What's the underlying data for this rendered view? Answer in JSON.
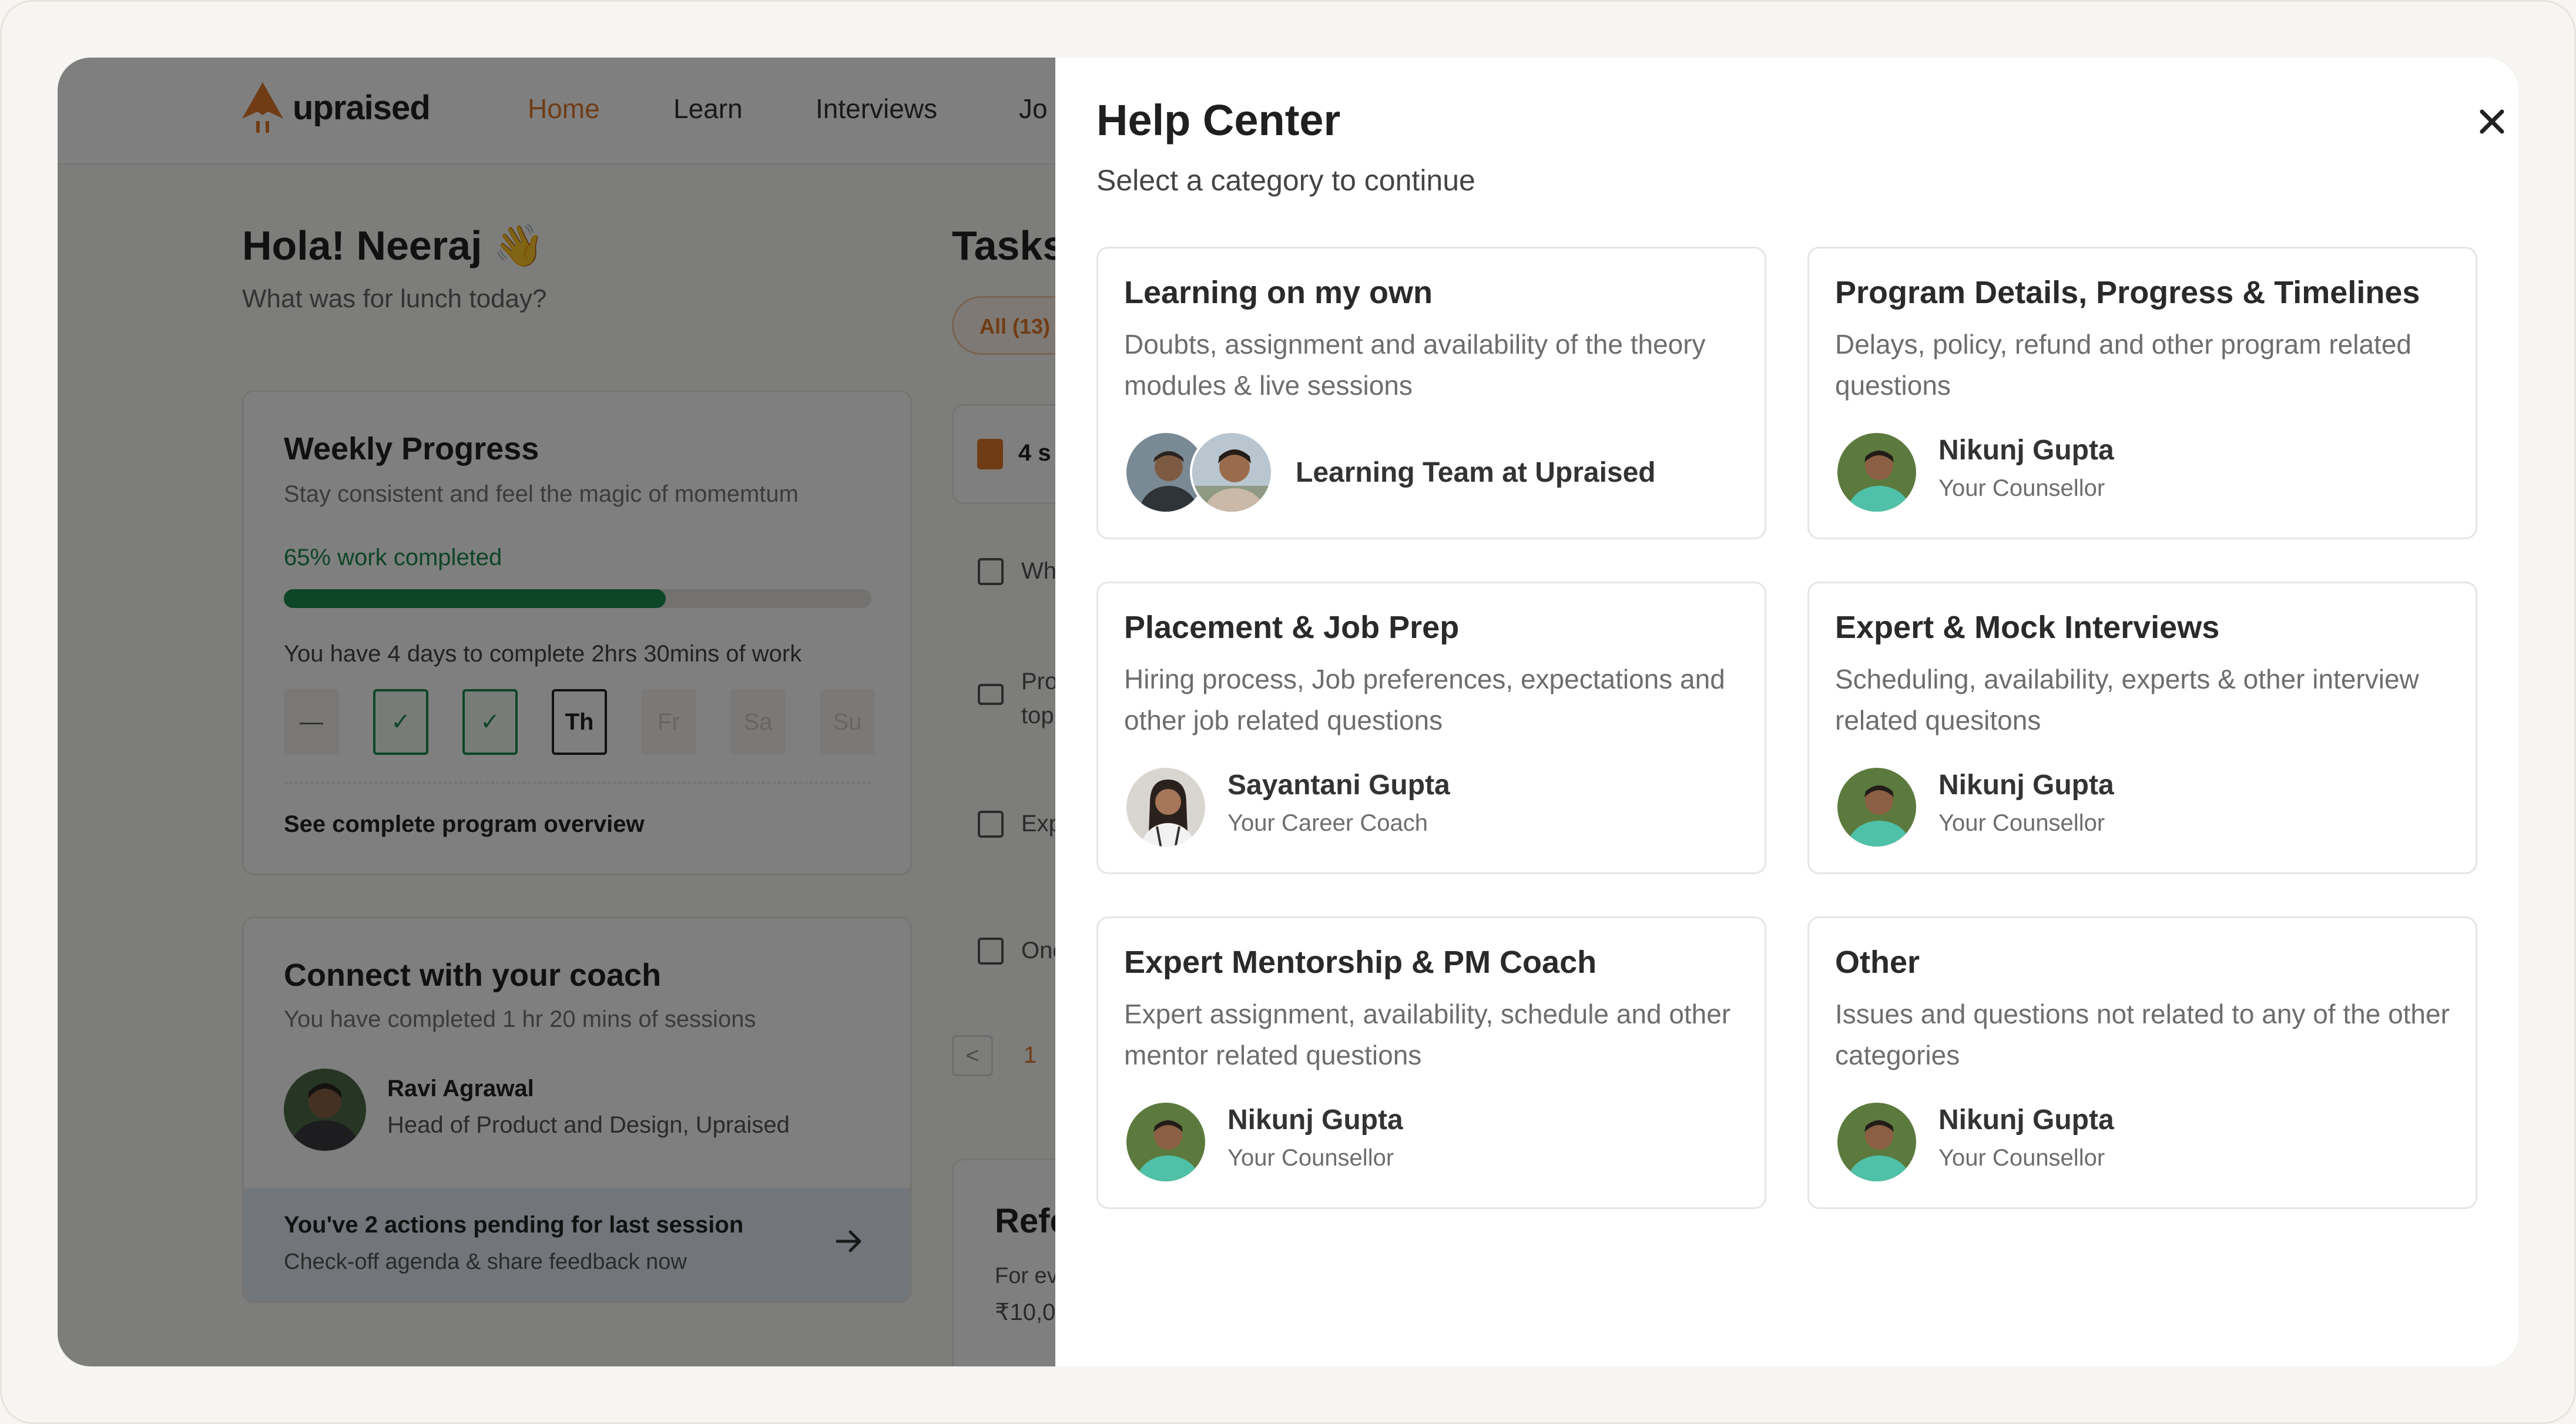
{
  "nav": {
    "brand": "upraised",
    "items": [
      {
        "label": "Home"
      },
      {
        "label": "Learn"
      },
      {
        "label": "Interviews"
      },
      {
        "label": "Jo"
      }
    ]
  },
  "dashboard": {
    "greeting": "Hola! Neeraj 👋",
    "greeting_sub": "What was for lunch today?",
    "weekly": {
      "title": "Weekly Progress",
      "subtitle": "Stay consistent and feel the magic of momemtum",
      "progress_label": "65% work completed",
      "progress_fraction": 0.65,
      "days_text": "You have 4 days to complete 2hrs 30mins of work",
      "days": [
        {
          "label": "—",
          "state": "dash"
        },
        {
          "label": "✓",
          "state": "done"
        },
        {
          "label": "✓",
          "state": "done"
        },
        {
          "label": "Th",
          "state": "today"
        },
        {
          "label": "Fr",
          "state": "future"
        },
        {
          "label": "Sa",
          "state": "future"
        },
        {
          "label": "Su",
          "state": "future"
        }
      ],
      "overview_link": "See complete program overview"
    },
    "coach": {
      "title": "Connect with your coach",
      "subtitle": "You have completed 1 hr 20 mins of sessions",
      "name": "Ravi Agrawal",
      "role": "Head of Product and Design, Upraised",
      "pending_title": "You've 2 actions pending for last session",
      "pending_sub": "Check-off agenda & share feedback now"
    },
    "tasks": {
      "title": "Tasks",
      "filter_pill": "All (13)",
      "featured": "4 s",
      "rows": [
        {
          "text": "Wh"
        },
        {
          "text": "Pro"
        },
        {
          "text": "top"
        },
        {
          "text": "Exp"
        },
        {
          "text": "One"
        }
      ],
      "pager_prev": "<",
      "page": "1",
      "referral_title": "Refe",
      "referral_line1": "For ev",
      "referral_line2": "₹10,0"
    }
  },
  "help_center": {
    "title": "Help Center",
    "subtitle": "Select a category to continue",
    "categories": [
      {
        "title": "Learning on my own",
        "description": "Doubts, assignment and availability of the theory modules & live sessions",
        "contact_name": "Learning Team at Upraised",
        "contact_role": ""
      },
      {
        "title": "Program Details, Progress & Timelines",
        "description": "Delays, policy, refund and other program related questions",
        "contact_name": "Nikunj Gupta",
        "contact_role": "Your Counsellor"
      },
      {
        "title": "Placement & Job Prep",
        "description": "Hiring process, Job preferences, expectations and other job related questions",
        "contact_name": "Sayantani  Gupta",
        "contact_role": "Your Career Coach"
      },
      {
        "title": "Expert & Mock Interviews",
        "description": "Scheduling, availability, experts & other interview related quesitons",
        "contact_name": "Nikunj Gupta",
        "contact_role": "Your Counsellor"
      },
      {
        "title": "Expert Mentorship & PM Coach",
        "description": "Expert assignment, availability, schedule and other mentor related questions",
        "contact_name": "Nikunj Gupta",
        "contact_role": "Your Counsellor"
      },
      {
        "title": "Other",
        "description": "Issues and questions not related to any of the other categories",
        "contact_name": "Nikunj Gupta",
        "contact_role": "Your Counsellor"
      }
    ]
  },
  "colors": {
    "accent": "#e0782a",
    "success": "#1a8a4e",
    "overlay": "#000000"
  }
}
